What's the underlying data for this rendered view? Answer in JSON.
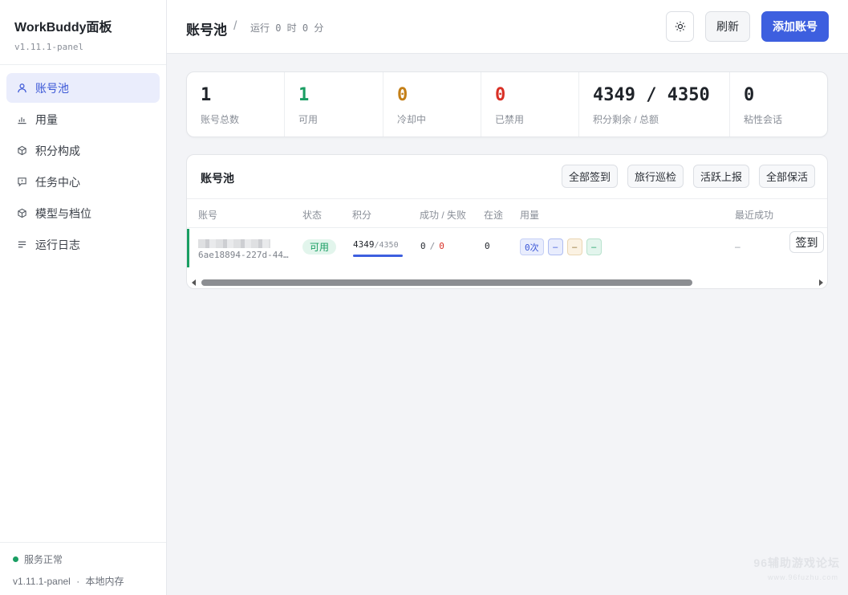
{
  "app": {
    "title": "WorkBuddy面板",
    "version": "v1.11.1-panel"
  },
  "sidebar": {
    "items": [
      {
        "label": "账号池",
        "icon": "user-icon",
        "active": true
      },
      {
        "label": "用量",
        "icon": "bar-chart-icon"
      },
      {
        "label": "积分构成",
        "icon": "cube-icon"
      },
      {
        "label": "任务中心",
        "icon": "message-icon"
      },
      {
        "label": "模型与档位",
        "icon": "box-icon"
      },
      {
        "label": "运行日志",
        "icon": "list-icon"
      }
    ],
    "status": "服务正常",
    "footer_version": "v1.11.1-panel",
    "footer_sep": "·",
    "footer_storage": "本地内存"
  },
  "header": {
    "title": "账号池",
    "separator": "/",
    "uptime": "运行 0 时 0 分",
    "theme_icon": "sun-icon",
    "refresh_label": "刷新",
    "add_label": "添加账号"
  },
  "stats": [
    {
      "value": "1",
      "label": "账号总数",
      "color": "#1f2329"
    },
    {
      "value": "1",
      "label": "可用",
      "color": "#1a9e63"
    },
    {
      "value": "0",
      "label": "冷却中",
      "color": "#c47f17"
    },
    {
      "value": "0",
      "label": "已禁用",
      "color": "#d93026"
    },
    {
      "value": "4349 / 4350",
      "label": "积分剩余 / 总额",
      "color": "#1f2329"
    },
    {
      "value": "0",
      "label": "粘性会话",
      "color": "#1f2329"
    }
  ],
  "pool": {
    "title": "账号池",
    "actions": [
      "全部签到",
      "旅行巡检",
      "活跃上报",
      "全部保活"
    ],
    "columns": [
      "账号",
      "状态",
      "积分",
      "成功 / 失败",
      "在途",
      "用量",
      "最近成功"
    ],
    "rows": [
      {
        "account_id": "6ae18894-227d-44…",
        "status": "可用",
        "credits": "4349",
        "credits_total": "/4350",
        "credits_fraction": 0.9998,
        "success": "0",
        "fail": "0",
        "sf_sep": "/",
        "in_flight": "0",
        "usage": [
          "0次",
          "–",
          "–",
          "–"
        ],
        "last_success": "–",
        "sign_label": "签到"
      }
    ]
  },
  "watermark": {
    "line1": "96辅助游戏论坛",
    "line2": "www.96fuzhu.com"
  }
}
